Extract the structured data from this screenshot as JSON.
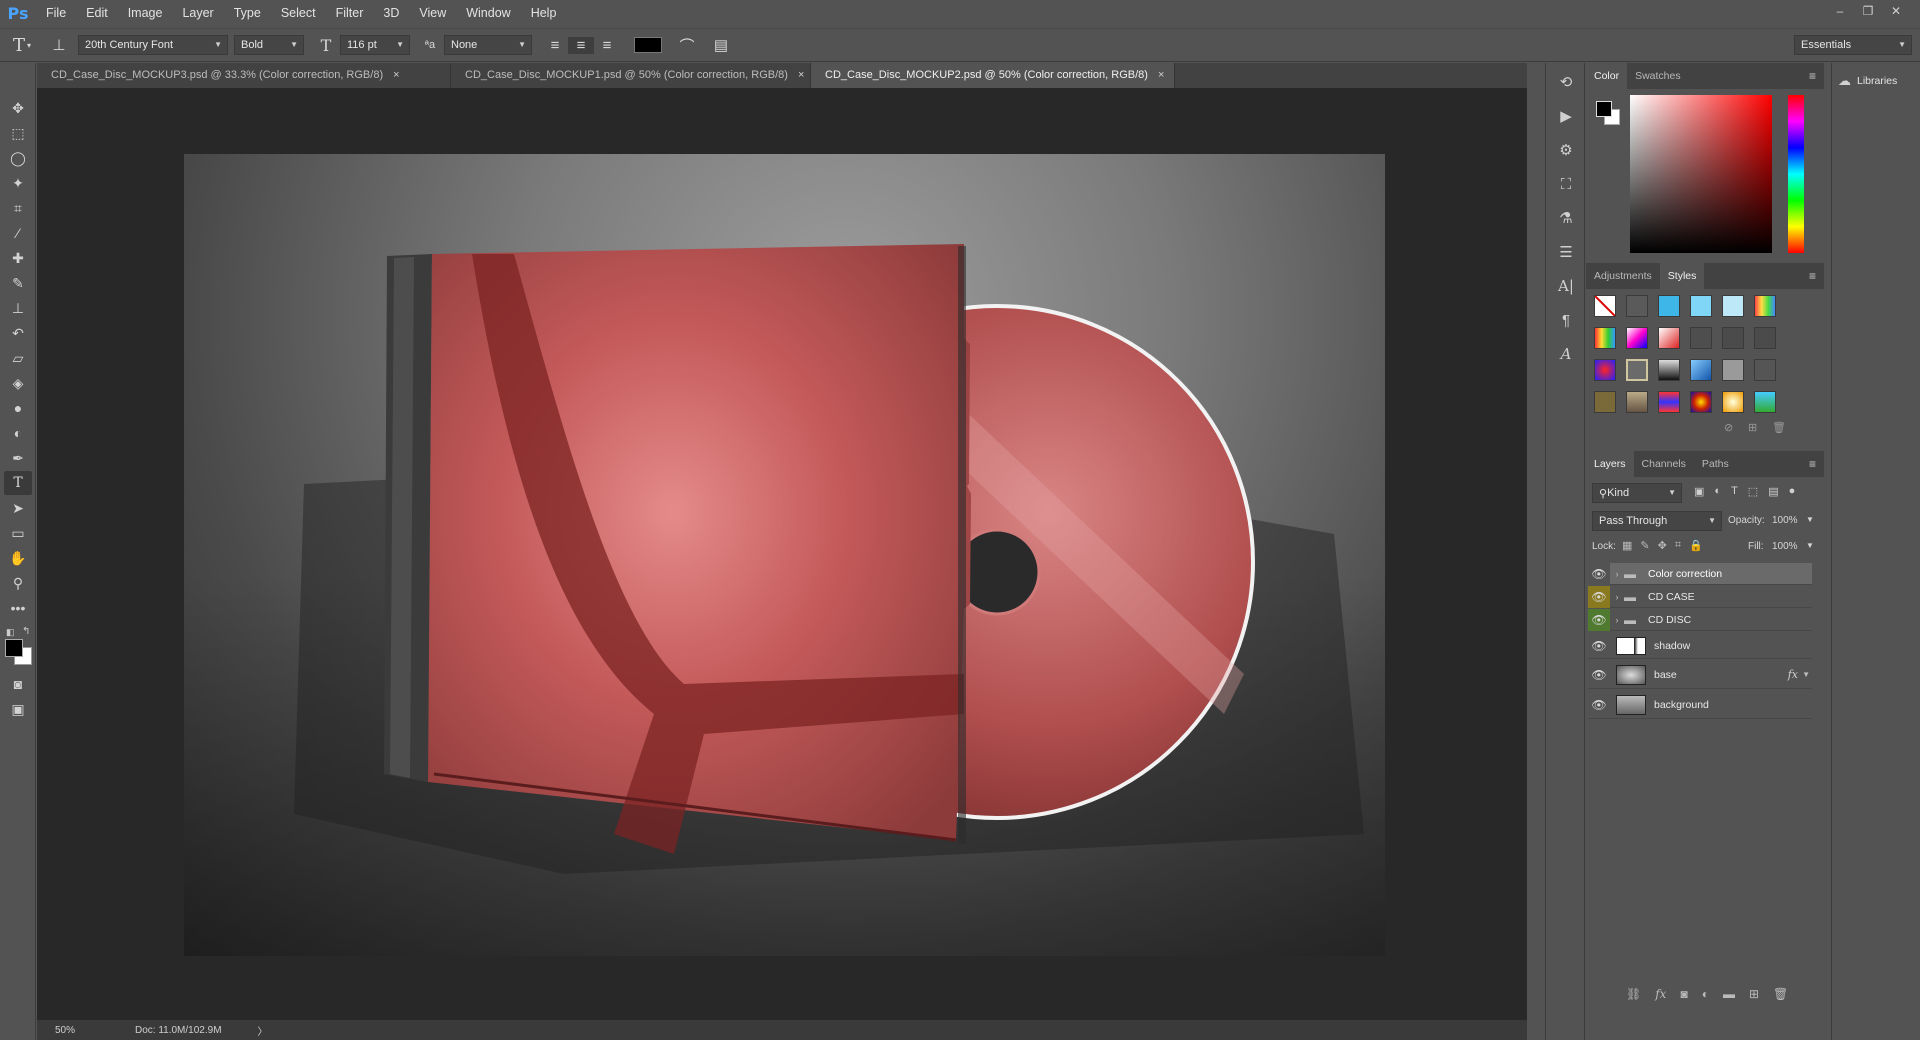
{
  "app": {
    "logo": "Ps"
  },
  "menu": [
    "File",
    "Edit",
    "Image",
    "Layer",
    "Type",
    "Select",
    "Filter",
    "3D",
    "View",
    "Window",
    "Help"
  ],
  "window_controls": {
    "minimize": "–",
    "restore": "❐",
    "close": "✕"
  },
  "options": {
    "font_family": "20th Century Font",
    "font_style": "Bold",
    "font_size": "116 pt",
    "aa_label": "ªa",
    "antialias": "None",
    "text_color": "#000000",
    "workspace": "Essentials"
  },
  "tabs": [
    {
      "label": "CD_Case_Disc_MOCKUP3.psd @ 33.3% (Color correction, RGB/8)",
      "close": "×"
    },
    {
      "label": "CD_Case_Disc_MOCKUP1.psd @ 50% (Color correction, RGB/8)",
      "close": "×"
    },
    {
      "label": "CD_Case_Disc_MOCKUP2.psd @ 50% (Color correction, RGB/8)",
      "close": "×"
    }
  ],
  "status": {
    "zoom": "50%",
    "doc": "Doc: 11.0M/102.9M",
    "arrow": "〉"
  },
  "color_panel": {
    "tabs": [
      "Color",
      "Swatches"
    ],
    "fg": "#000000",
    "bg": "#ffffff",
    "hue": "#ff0000"
  },
  "styles_panel": {
    "tabs": [
      "Adjustments",
      "Styles"
    ]
  },
  "layers_panel": {
    "tabs": [
      "Layers",
      "Channels",
      "Paths"
    ],
    "filter_kind": "Kind",
    "blend_mode": "Pass Through",
    "opacity_label": "Opacity:",
    "opacity": "100%",
    "lock_label": "Lock:",
    "fill_label": "Fill:",
    "fill": "100%",
    "layers": [
      {
        "name": "Color correction",
        "type": "group",
        "selected": true,
        "eye_color": "#535353"
      },
      {
        "name": "CD CASE",
        "type": "group",
        "selected": false,
        "eye_color": "#8a7a1f"
      },
      {
        "name": "CD DISC",
        "type": "group",
        "selected": false,
        "eye_color": "#4f7a2f"
      },
      {
        "name": "shadow",
        "type": "pixel",
        "selected": false,
        "eye_color": "#535353"
      },
      {
        "name": "base",
        "type": "pixel",
        "selected": false,
        "eye_color": "#535353",
        "fx": "fx"
      },
      {
        "name": "background",
        "type": "pixel",
        "selected": false,
        "eye_color": "#535353"
      }
    ]
  },
  "libraries": {
    "label": "Libraries"
  },
  "colors": {
    "accent": "#c45050",
    "canvas_bg": "#282828",
    "ui": "#535353"
  }
}
